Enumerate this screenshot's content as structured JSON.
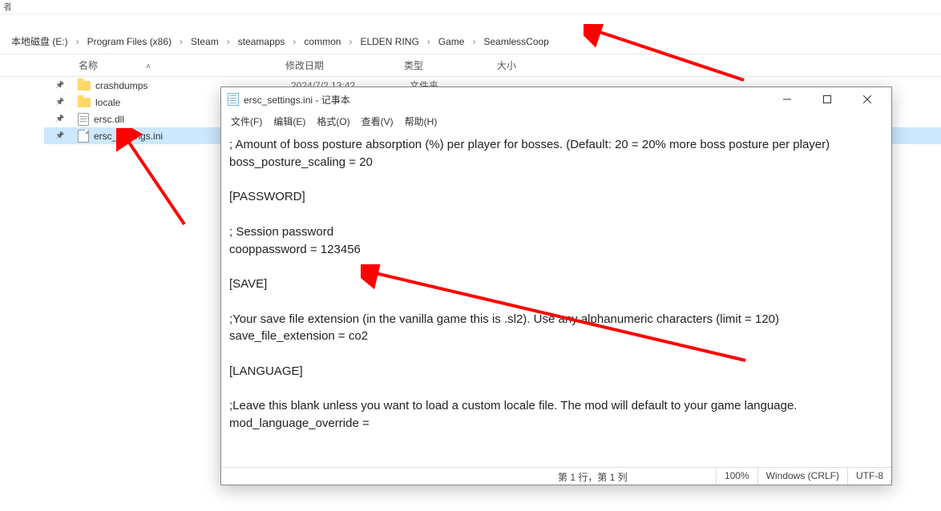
{
  "topbar_char": "者",
  "breadcrumb": [
    "本地磁盘 (E:)",
    "Program Files (x86)",
    "Steam",
    "steamapps",
    "common",
    "ELDEN RING",
    "Game",
    "SeamlessCoop"
  ],
  "headers": {
    "name": "名称",
    "date": "修改日期",
    "type": "类型",
    "size": "大小"
  },
  "files": [
    {
      "name": "crashdumps",
      "date": "2024/7/2 13:42",
      "type": "文件夹",
      "icon": "folder",
      "selected": false
    },
    {
      "name": "locale",
      "date": "",
      "type": "",
      "icon": "folder",
      "selected": false
    },
    {
      "name": "ersc.dll",
      "date": "",
      "type": "",
      "icon": "dll",
      "selected": false
    },
    {
      "name": "ersc_settings.ini",
      "date": "",
      "type": "",
      "icon": "ini",
      "selected": true
    }
  ],
  "notepad": {
    "title": "ersc_settings.ini - 记事本",
    "menus": [
      "文件(F)",
      "编辑(E)",
      "格式(O)",
      "查看(V)",
      "帮助(H)"
    ],
    "content": "; Amount of boss posture absorption (%) per player for bosses. (Default: 20 = 20% more boss posture per player)\nboss_posture_scaling = 20\n\n[PASSWORD]\n\n; Session password\ncooppassword = 123456\n\n[SAVE]\n\n;Your save file extension (in the vanilla game this is .sl2). Use any alphanumeric characters (limit = 120)\nsave_file_extension = co2\n\n[LANGUAGE]\n\n;Leave this blank unless you want to load a custom locale file. The mod will default to your game language.\nmod_language_override =",
    "status": {
      "pos": "第 1 行，第 1 列",
      "zoom": "100%",
      "eol": "Windows (CRLF)",
      "enc": "UTF-8"
    }
  }
}
